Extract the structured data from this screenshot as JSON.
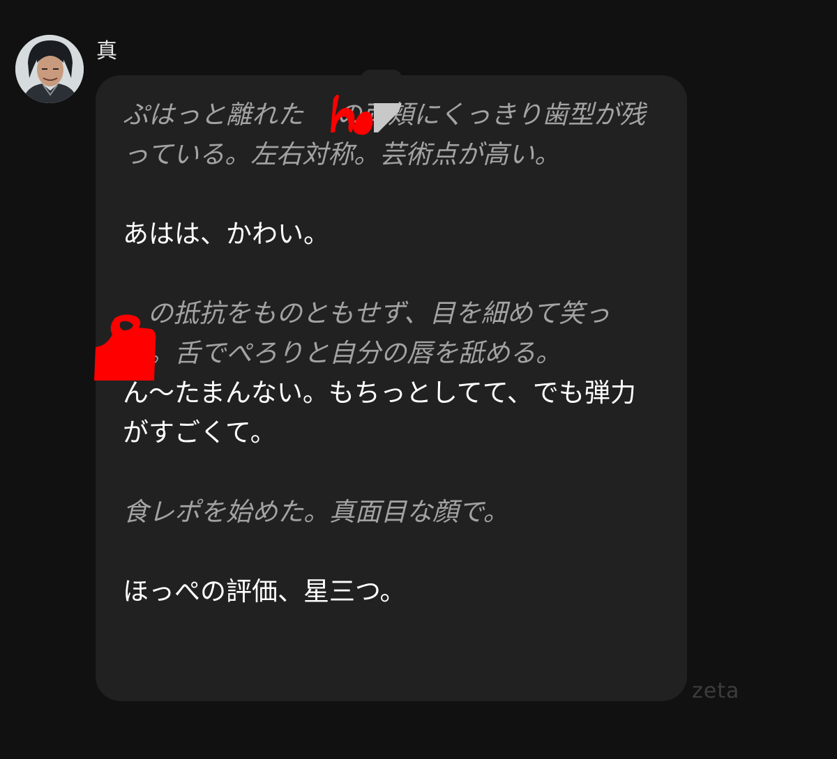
{
  "sender": {
    "name": "真"
  },
  "message": {
    "blocks": [
      {
        "type": "narration",
        "text": "ぷはっと離れた    の両頬にくっきり歯型が残っている。左右対称。芸術点が高い。"
      },
      {
        "type": "gap"
      },
      {
        "type": "speech",
        "text": "あはは、かわい。"
      },
      {
        "type": "gap"
      },
      {
        "type": "narration",
        "text": "   の抵抗をものともせず、目を細めて笑った。舌でぺろりと自分の唇を舐める。"
      },
      {
        "type": "speech",
        "text": "ん〜たまんない。もちっとしてて、でも弾力がすごくて。"
      },
      {
        "type": "gap"
      },
      {
        "type": "narration",
        "text": "食レポを始めた。真面目な顔で。"
      },
      {
        "type": "gap"
      },
      {
        "type": "speech",
        "text": "ほっぺの評価、星三つ。"
      }
    ]
  },
  "watermark": "zeta",
  "colors": {
    "background": "#111111",
    "bubble": "#212121",
    "narration_text": "#a3a3a3",
    "speech_text": "#ffffff",
    "redaction": "#ff0000"
  }
}
